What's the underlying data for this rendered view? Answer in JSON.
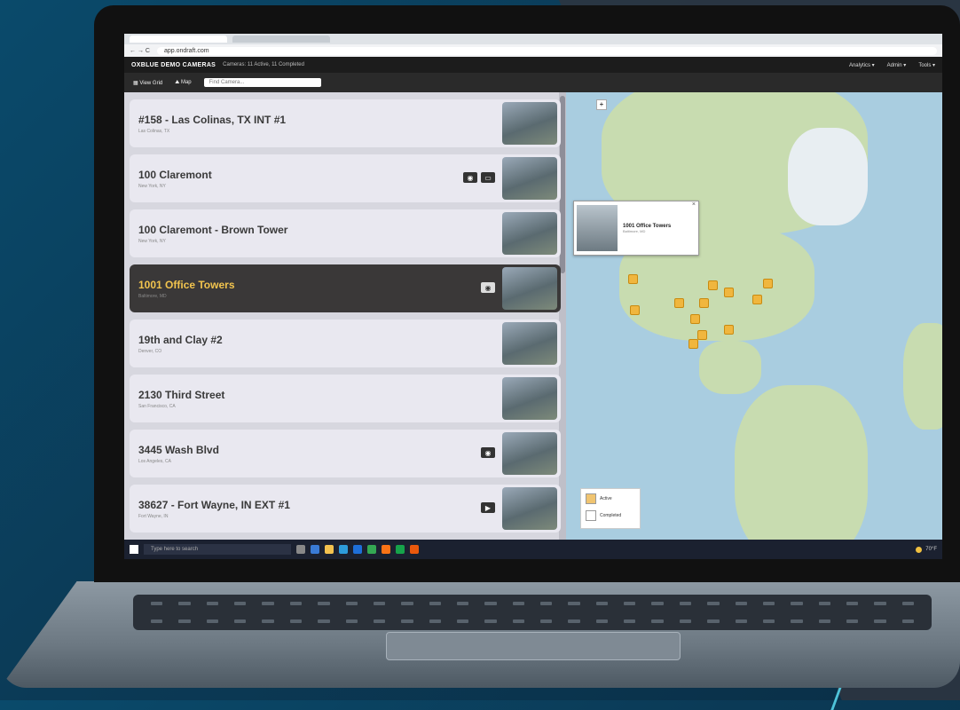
{
  "browser": {
    "url": "app.ondraft.com",
    "controls": "← → C"
  },
  "app": {
    "title": "OXBLUE DEMO CAMERAS",
    "subtitle": "Cameras: 11 Active, 11 Completed",
    "menu": [
      "Analytics ▾",
      "Admin ▾",
      "Tools ▾"
    ]
  },
  "toolbar": {
    "list_view": "View Grid",
    "map_view": "Map",
    "search_placeholder": "Find Camera..."
  },
  "cameras": [
    {
      "name": "#158 - Las Colinas, TX INT #1",
      "location": "Las Colinas, TX",
      "icons": []
    },
    {
      "name": "100 Claremont",
      "location": "New York, NY",
      "icons": [
        "cam",
        "pano"
      ]
    },
    {
      "name": "100 Claremont - Brown Tower",
      "location": "New York, NY",
      "icons": []
    },
    {
      "name": "1001 Office Towers",
      "location": "Baltimore, MD",
      "icons": [
        "cam"
      ],
      "selected": true
    },
    {
      "name": "19th and Clay #2",
      "location": "Denver, CO",
      "icons": []
    },
    {
      "name": "2130 Third Street",
      "location": "San Francisco, CA",
      "icons": []
    },
    {
      "name": "3445 Wash Blvd",
      "location": "Los Angeles, CA",
      "icons": [
        "cam"
      ]
    },
    {
      "name": "38627 - Fort Wayne, IN EXT #1",
      "location": "Fort Wayne, IN",
      "icons": [
        "video"
      ]
    }
  ],
  "map": {
    "popup_title": "1001 Office Towers",
    "popup_sub": "Baltimore, MD",
    "legend": [
      "Active",
      "Completed"
    ],
    "legend_colors": [
      "#f0c470",
      "#ffffff"
    ]
  },
  "taskbar": {
    "search": "Type here to search",
    "tray": "70°F"
  }
}
